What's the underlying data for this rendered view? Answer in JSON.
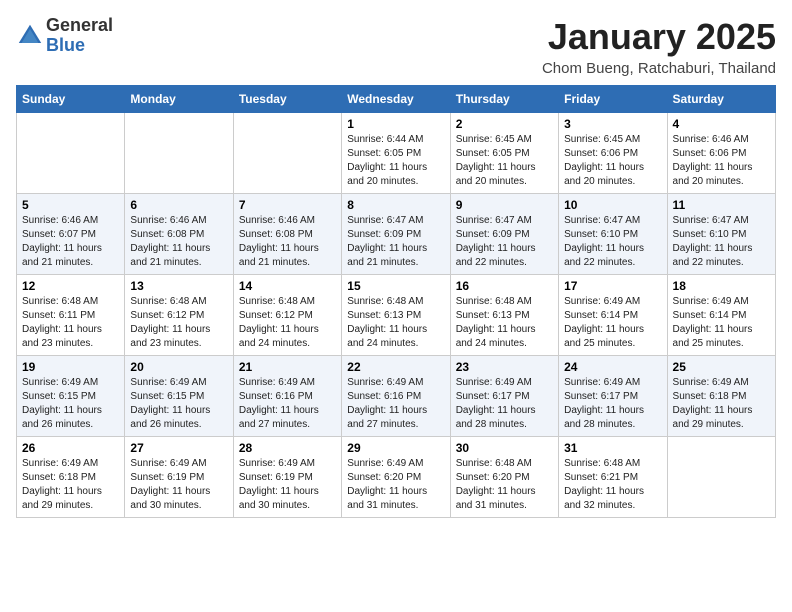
{
  "logo": {
    "general": "General",
    "blue": "Blue"
  },
  "title": "January 2025",
  "location": "Chom Bueng, Ratchaburi, Thailand",
  "weekdays": [
    "Sunday",
    "Monday",
    "Tuesday",
    "Wednesday",
    "Thursday",
    "Friday",
    "Saturday"
  ],
  "weeks": [
    [
      {
        "day": "",
        "sunrise": "",
        "sunset": "",
        "daylight": ""
      },
      {
        "day": "",
        "sunrise": "",
        "sunset": "",
        "daylight": ""
      },
      {
        "day": "",
        "sunrise": "",
        "sunset": "",
        "daylight": ""
      },
      {
        "day": "1",
        "sunrise": "Sunrise: 6:44 AM",
        "sunset": "Sunset: 6:05 PM",
        "daylight": "Daylight: 11 hours and 20 minutes."
      },
      {
        "day": "2",
        "sunrise": "Sunrise: 6:45 AM",
        "sunset": "Sunset: 6:05 PM",
        "daylight": "Daylight: 11 hours and 20 minutes."
      },
      {
        "day": "3",
        "sunrise": "Sunrise: 6:45 AM",
        "sunset": "Sunset: 6:06 PM",
        "daylight": "Daylight: 11 hours and 20 minutes."
      },
      {
        "day": "4",
        "sunrise": "Sunrise: 6:46 AM",
        "sunset": "Sunset: 6:06 PM",
        "daylight": "Daylight: 11 hours and 20 minutes."
      }
    ],
    [
      {
        "day": "5",
        "sunrise": "Sunrise: 6:46 AM",
        "sunset": "Sunset: 6:07 PM",
        "daylight": "Daylight: 11 hours and 21 minutes."
      },
      {
        "day": "6",
        "sunrise": "Sunrise: 6:46 AM",
        "sunset": "Sunset: 6:08 PM",
        "daylight": "Daylight: 11 hours and 21 minutes."
      },
      {
        "day": "7",
        "sunrise": "Sunrise: 6:46 AM",
        "sunset": "Sunset: 6:08 PM",
        "daylight": "Daylight: 11 hours and 21 minutes."
      },
      {
        "day": "8",
        "sunrise": "Sunrise: 6:47 AM",
        "sunset": "Sunset: 6:09 PM",
        "daylight": "Daylight: 11 hours and 21 minutes."
      },
      {
        "day": "9",
        "sunrise": "Sunrise: 6:47 AM",
        "sunset": "Sunset: 6:09 PM",
        "daylight": "Daylight: 11 hours and 22 minutes."
      },
      {
        "day": "10",
        "sunrise": "Sunrise: 6:47 AM",
        "sunset": "Sunset: 6:10 PM",
        "daylight": "Daylight: 11 hours and 22 minutes."
      },
      {
        "day": "11",
        "sunrise": "Sunrise: 6:47 AM",
        "sunset": "Sunset: 6:10 PM",
        "daylight": "Daylight: 11 hours and 22 minutes."
      }
    ],
    [
      {
        "day": "12",
        "sunrise": "Sunrise: 6:48 AM",
        "sunset": "Sunset: 6:11 PM",
        "daylight": "Daylight: 11 hours and 23 minutes."
      },
      {
        "day": "13",
        "sunrise": "Sunrise: 6:48 AM",
        "sunset": "Sunset: 6:12 PM",
        "daylight": "Daylight: 11 hours and 23 minutes."
      },
      {
        "day": "14",
        "sunrise": "Sunrise: 6:48 AM",
        "sunset": "Sunset: 6:12 PM",
        "daylight": "Daylight: 11 hours and 24 minutes."
      },
      {
        "day": "15",
        "sunrise": "Sunrise: 6:48 AM",
        "sunset": "Sunset: 6:13 PM",
        "daylight": "Daylight: 11 hours and 24 minutes."
      },
      {
        "day": "16",
        "sunrise": "Sunrise: 6:48 AM",
        "sunset": "Sunset: 6:13 PM",
        "daylight": "Daylight: 11 hours and 24 minutes."
      },
      {
        "day": "17",
        "sunrise": "Sunrise: 6:49 AM",
        "sunset": "Sunset: 6:14 PM",
        "daylight": "Daylight: 11 hours and 25 minutes."
      },
      {
        "day": "18",
        "sunrise": "Sunrise: 6:49 AM",
        "sunset": "Sunset: 6:14 PM",
        "daylight": "Daylight: 11 hours and 25 minutes."
      }
    ],
    [
      {
        "day": "19",
        "sunrise": "Sunrise: 6:49 AM",
        "sunset": "Sunset: 6:15 PM",
        "daylight": "Daylight: 11 hours and 26 minutes."
      },
      {
        "day": "20",
        "sunrise": "Sunrise: 6:49 AM",
        "sunset": "Sunset: 6:15 PM",
        "daylight": "Daylight: 11 hours and 26 minutes."
      },
      {
        "day": "21",
        "sunrise": "Sunrise: 6:49 AM",
        "sunset": "Sunset: 6:16 PM",
        "daylight": "Daylight: 11 hours and 27 minutes."
      },
      {
        "day": "22",
        "sunrise": "Sunrise: 6:49 AM",
        "sunset": "Sunset: 6:16 PM",
        "daylight": "Daylight: 11 hours and 27 minutes."
      },
      {
        "day": "23",
        "sunrise": "Sunrise: 6:49 AM",
        "sunset": "Sunset: 6:17 PM",
        "daylight": "Daylight: 11 hours and 28 minutes."
      },
      {
        "day": "24",
        "sunrise": "Sunrise: 6:49 AM",
        "sunset": "Sunset: 6:17 PM",
        "daylight": "Daylight: 11 hours and 28 minutes."
      },
      {
        "day": "25",
        "sunrise": "Sunrise: 6:49 AM",
        "sunset": "Sunset: 6:18 PM",
        "daylight": "Daylight: 11 hours and 29 minutes."
      }
    ],
    [
      {
        "day": "26",
        "sunrise": "Sunrise: 6:49 AM",
        "sunset": "Sunset: 6:18 PM",
        "daylight": "Daylight: 11 hours and 29 minutes."
      },
      {
        "day": "27",
        "sunrise": "Sunrise: 6:49 AM",
        "sunset": "Sunset: 6:19 PM",
        "daylight": "Daylight: 11 hours and 30 minutes."
      },
      {
        "day": "28",
        "sunrise": "Sunrise: 6:49 AM",
        "sunset": "Sunset: 6:19 PM",
        "daylight": "Daylight: 11 hours and 30 minutes."
      },
      {
        "day": "29",
        "sunrise": "Sunrise: 6:49 AM",
        "sunset": "Sunset: 6:20 PM",
        "daylight": "Daylight: 11 hours and 31 minutes."
      },
      {
        "day": "30",
        "sunrise": "Sunrise: 6:48 AM",
        "sunset": "Sunset: 6:20 PM",
        "daylight": "Daylight: 11 hours and 31 minutes."
      },
      {
        "day": "31",
        "sunrise": "Sunrise: 6:48 AM",
        "sunset": "Sunset: 6:21 PM",
        "daylight": "Daylight: 11 hours and 32 minutes."
      },
      {
        "day": "",
        "sunrise": "",
        "sunset": "",
        "daylight": ""
      }
    ]
  ]
}
